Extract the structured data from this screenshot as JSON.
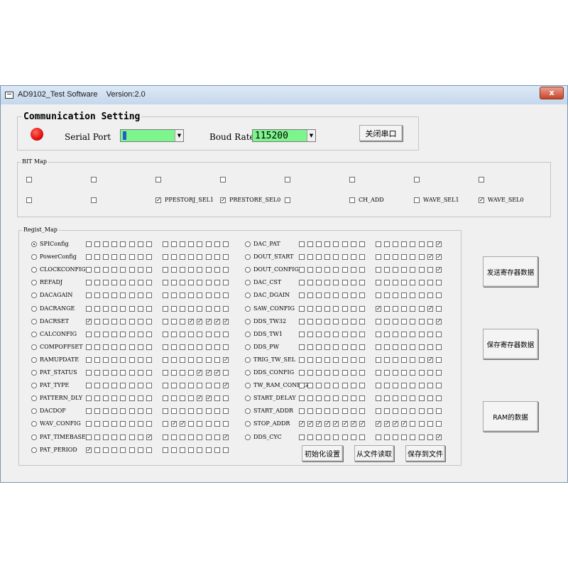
{
  "window": {
    "title": "AD9102_Test Software    Version:2.0",
    "close_label": "x"
  },
  "comm": {
    "title": "Communication Setting",
    "serial_port_label": "Serial Port",
    "serial_port_value": "",
    "baud_rate_label": "Boud Rate",
    "baud_rate_value": "115200",
    "close_port_button": "关闭串口",
    "status_led_color": "#e01010"
  },
  "bitmap": {
    "title": "BIT Map",
    "row1": [
      {
        "label": "",
        "checked": false
      },
      {
        "label": "",
        "checked": false
      },
      {
        "label": "",
        "checked": false
      },
      {
        "label": "",
        "checked": false
      },
      {
        "label": "",
        "checked": false
      },
      {
        "label": "",
        "checked": false
      },
      {
        "label": "",
        "checked": false
      },
      {
        "label": "",
        "checked": false
      }
    ],
    "row2": [
      {
        "label": "",
        "checked": false
      },
      {
        "label": "",
        "checked": false
      },
      {
        "label": "PPESTORJ_SEL1",
        "checked": true
      },
      {
        "label": "PRESTORE_SEL0",
        "checked": true
      },
      {
        "label": "",
        "checked": false
      },
      {
        "label": "CH_ADD",
        "checked": false
      },
      {
        "label": "WAVE_SEL1",
        "checked": false
      },
      {
        "label": "WAVE_SEL0",
        "checked": true
      }
    ]
  },
  "regmap": {
    "title": "Regist_Map",
    "left_registers": [
      {
        "name": "SPIConfig",
        "selected": true,
        "bits": "0000000000000000"
      },
      {
        "name": "PowerConfig",
        "selected": false,
        "bits": "0000000000000000"
      },
      {
        "name": "CLOCKCONFIG",
        "selected": false,
        "bits": "0000000000000000"
      },
      {
        "name": "REFADJ",
        "selected": false,
        "bits": "0000000000000000"
      },
      {
        "name": "DACAGAIN",
        "selected": false,
        "bits": "0000000000000000"
      },
      {
        "name": "DACRANGE",
        "selected": false,
        "bits": "0000000000000000"
      },
      {
        "name": "DACRSET",
        "selected": false,
        "bits": "1000000000011111"
      },
      {
        "name": "CALCONFIG",
        "selected": false,
        "bits": "0000000000000000"
      },
      {
        "name": "COMPOFFSET",
        "selected": false,
        "bits": "0000000000000000"
      },
      {
        "name": "RAMUPDATE",
        "selected": false,
        "bits": "0000000000000001"
      },
      {
        "name": "PAT_STATUS",
        "selected": false,
        "bits": "0000000000001110"
      },
      {
        "name": "PAT_TYPE",
        "selected": false,
        "bits": "0000000000000001"
      },
      {
        "name": "PATTERN_DLY",
        "selected": false,
        "bits": "0000000000001100"
      },
      {
        "name": "DACDOF",
        "selected": false,
        "bits": "0000000000000000"
      },
      {
        "name": "WAV_CONFIG",
        "selected": false,
        "bits": "0000000001100000"
      },
      {
        "name": "PAT_TIMEBASE",
        "selected": false,
        "bits": "0000000100000001"
      },
      {
        "name": "PAT_PERIOD",
        "selected": false,
        "bits": "1000000000000000"
      }
    ],
    "right_registers": [
      {
        "name": "DAC_PAT",
        "selected": false,
        "bits": "0000000000000001"
      },
      {
        "name": "DOUT_START",
        "selected": false,
        "bits": "0000000000000011"
      },
      {
        "name": "DOUT_CONFIG",
        "selected": false,
        "bits": "0000000000000001"
      },
      {
        "name": "DAC_CST",
        "selected": false,
        "bits": "0000000000000000"
      },
      {
        "name": "DAC_DGAIN",
        "selected": false,
        "bits": "0000000000000000"
      },
      {
        "name": "SAW_CONFIG",
        "selected": false,
        "bits": "0000000010000010"
      },
      {
        "name": "DDS_TW32",
        "selected": false,
        "bits": "0000000000000001"
      },
      {
        "name": "DDS_TW1",
        "selected": false,
        "bits": "0000000000000000"
      },
      {
        "name": "DDS_PW",
        "selected": false,
        "bits": "0000000000000000"
      },
      {
        "name": "TRIG_TW_SEL",
        "selected": false,
        "bits": "0000000000000010"
      },
      {
        "name": "DDS_CONFIG",
        "selected": false,
        "bits": "0000000000000000"
      },
      {
        "name": "TW_RAM_CONFIG",
        "selected": false,
        "bits": "0000000000000000"
      },
      {
        "name": "START_DELAY",
        "selected": false,
        "bits": "0000000000000000"
      },
      {
        "name": "START_ADDR",
        "selected": false,
        "bits": "0000000000000000"
      },
      {
        "name": "STOP_ADDR",
        "selected": false,
        "bits": "1111111111110000"
      },
      {
        "name": "DDS_CYC",
        "selected": false,
        "bits": "0000000000000001"
      }
    ],
    "init_button": "初始化设置",
    "read_file_button": "从文件读取",
    "save_file_button": "保存到文件"
  },
  "side_buttons": {
    "send_register": "发送寄存器数据",
    "save_register": "保存寄存器数据",
    "ram_data": "RAM的数据"
  }
}
